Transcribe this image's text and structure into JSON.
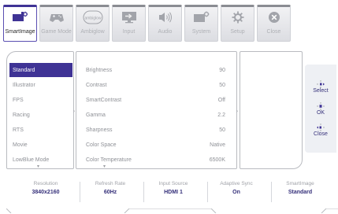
{
  "tabs": [
    {
      "label": "SmartImage",
      "icon": "smartimage-icon",
      "active": true
    },
    {
      "label": "Game Mode",
      "icon": "gamepad-icon",
      "active": false
    },
    {
      "label": "Ambiglow",
      "icon": "ambiglow-icon",
      "icon_text": "ambiglow",
      "active": false
    },
    {
      "label": "Input",
      "icon": "input-icon",
      "active": false
    },
    {
      "label": "Audio",
      "icon": "speaker-icon",
      "active": false
    },
    {
      "label": "System",
      "icon": "system-icon",
      "active": false
    },
    {
      "label": "Setup",
      "icon": "gear-icon",
      "active": false
    },
    {
      "label": "Close",
      "icon": "close-icon",
      "active": false
    }
  ],
  "menu": {
    "items": [
      "Standard",
      "Illustrator",
      "FPS",
      "Racing",
      "RTS",
      "Movie",
      "LowBlue Mode"
    ],
    "selected": "Standard"
  },
  "settings": [
    {
      "name": "Brightness",
      "value": "90"
    },
    {
      "name": "Contrast",
      "value": "50"
    },
    {
      "name": "SmartContrast",
      "value": "Off"
    },
    {
      "name": "Gamma",
      "value": "2.2"
    },
    {
      "name": "Sharpness",
      "value": "50"
    },
    {
      "name": "Color Space",
      "value": "Native"
    },
    {
      "name": "Color Temperature",
      "value": "6500K"
    }
  ],
  "side_actions": [
    "Select",
    "OK",
    "Close"
  ],
  "status": [
    {
      "label": "Resolution",
      "value": "3840x2160"
    },
    {
      "label": "Refresh Rate",
      "value": "60Hz"
    },
    {
      "label": "Input Source",
      "value": "HDMI 1"
    },
    {
      "label": "Adaptive Sync",
      "value": "On"
    },
    {
      "label": "SmartImage",
      "value": "Standard"
    }
  ],
  "colors": {
    "accent": "#3f3395",
    "text_muted": "#8e9096",
    "border": "#b9bbc0"
  }
}
